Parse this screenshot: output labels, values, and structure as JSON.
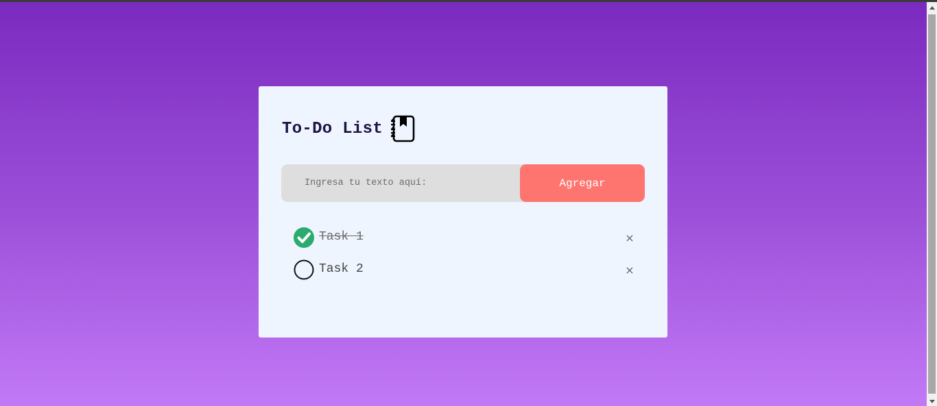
{
  "app": {
    "title": "To-Do List",
    "title_icon": "notebook-icon"
  },
  "form": {
    "input_placeholder": "Ingresa tu texto aquí:",
    "input_value": "",
    "add_label": "Agregar"
  },
  "tasks": [
    {
      "text": "Task 1",
      "completed": true,
      "delete_label": "×"
    },
    {
      "text": "Task 2",
      "completed": false,
      "delete_label": "×"
    }
  ],
  "colors": {
    "background_top": "#7b2abf",
    "background_bottom": "#c279f6",
    "card": "#eef5fe",
    "title": "#1f1342",
    "button": "#fe7570",
    "check": "#2bab6e"
  }
}
